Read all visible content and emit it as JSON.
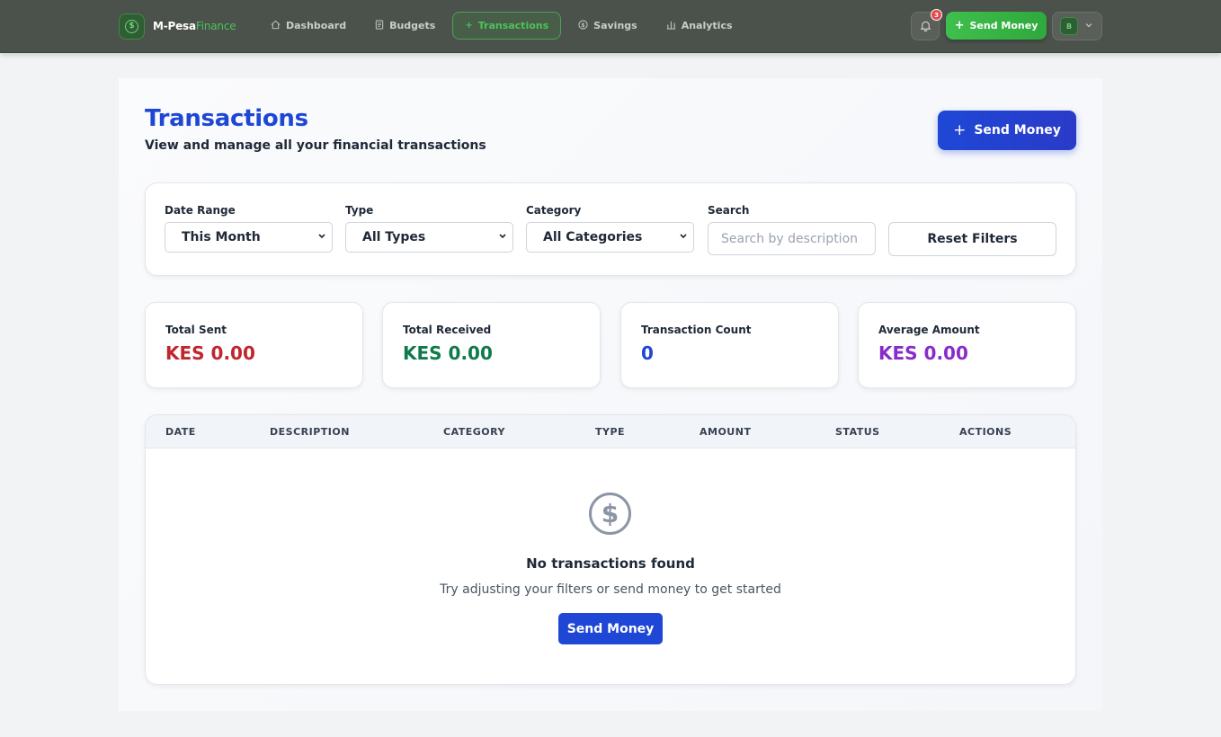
{
  "brand": {
    "name": "M-Pesa",
    "accent": "Finance"
  },
  "nav": {
    "items": [
      {
        "label": "Dashboard",
        "icon": "home-icon",
        "active": false
      },
      {
        "label": "Budgets",
        "icon": "document-icon",
        "active": false
      },
      {
        "label": "Transactions",
        "icon": "plus-icon",
        "active": true
      },
      {
        "label": "Savings",
        "icon": "coin-icon",
        "active": false
      },
      {
        "label": "Analytics",
        "icon": "bar-chart-icon",
        "active": false
      }
    ],
    "notification_count": "3",
    "send_label": "Send Money",
    "user_initial": "B"
  },
  "page": {
    "title": "Transactions",
    "subtitle": "View and manage all your financial transactions",
    "send_label": "Send Money"
  },
  "filters": {
    "date_range": {
      "label": "Date Range",
      "value": "This Month"
    },
    "type": {
      "label": "Type",
      "value": "All Types"
    },
    "category": {
      "label": "Category",
      "value": "All Categories"
    },
    "search": {
      "label": "Search",
      "placeholder": "Search by description"
    },
    "reset_label": "Reset Filters"
  },
  "stats": [
    {
      "label": "Total Sent",
      "value": "KES 0.00",
      "color": "#c0262d"
    },
    {
      "label": "Total Received",
      "value": "KES 0.00",
      "color": "#0f7a4a"
    },
    {
      "label": "Transaction Count",
      "value": "0",
      "color": "#1f47d6"
    },
    {
      "label": "Average Amount",
      "value": "KES 0.00",
      "color": "#8a2bc9"
    }
  ],
  "table": {
    "columns": [
      "DATE",
      "DESCRIPTION",
      "CATEGORY",
      "TYPE",
      "AMOUNT",
      "STATUS",
      "ACTIONS"
    ],
    "empty": {
      "icon": "dollar-circle-icon",
      "glyph": "$",
      "title": "No transactions found",
      "subtitle": "Try adjusting your filters or send money to get started",
      "button_label": "Send Money"
    }
  }
}
